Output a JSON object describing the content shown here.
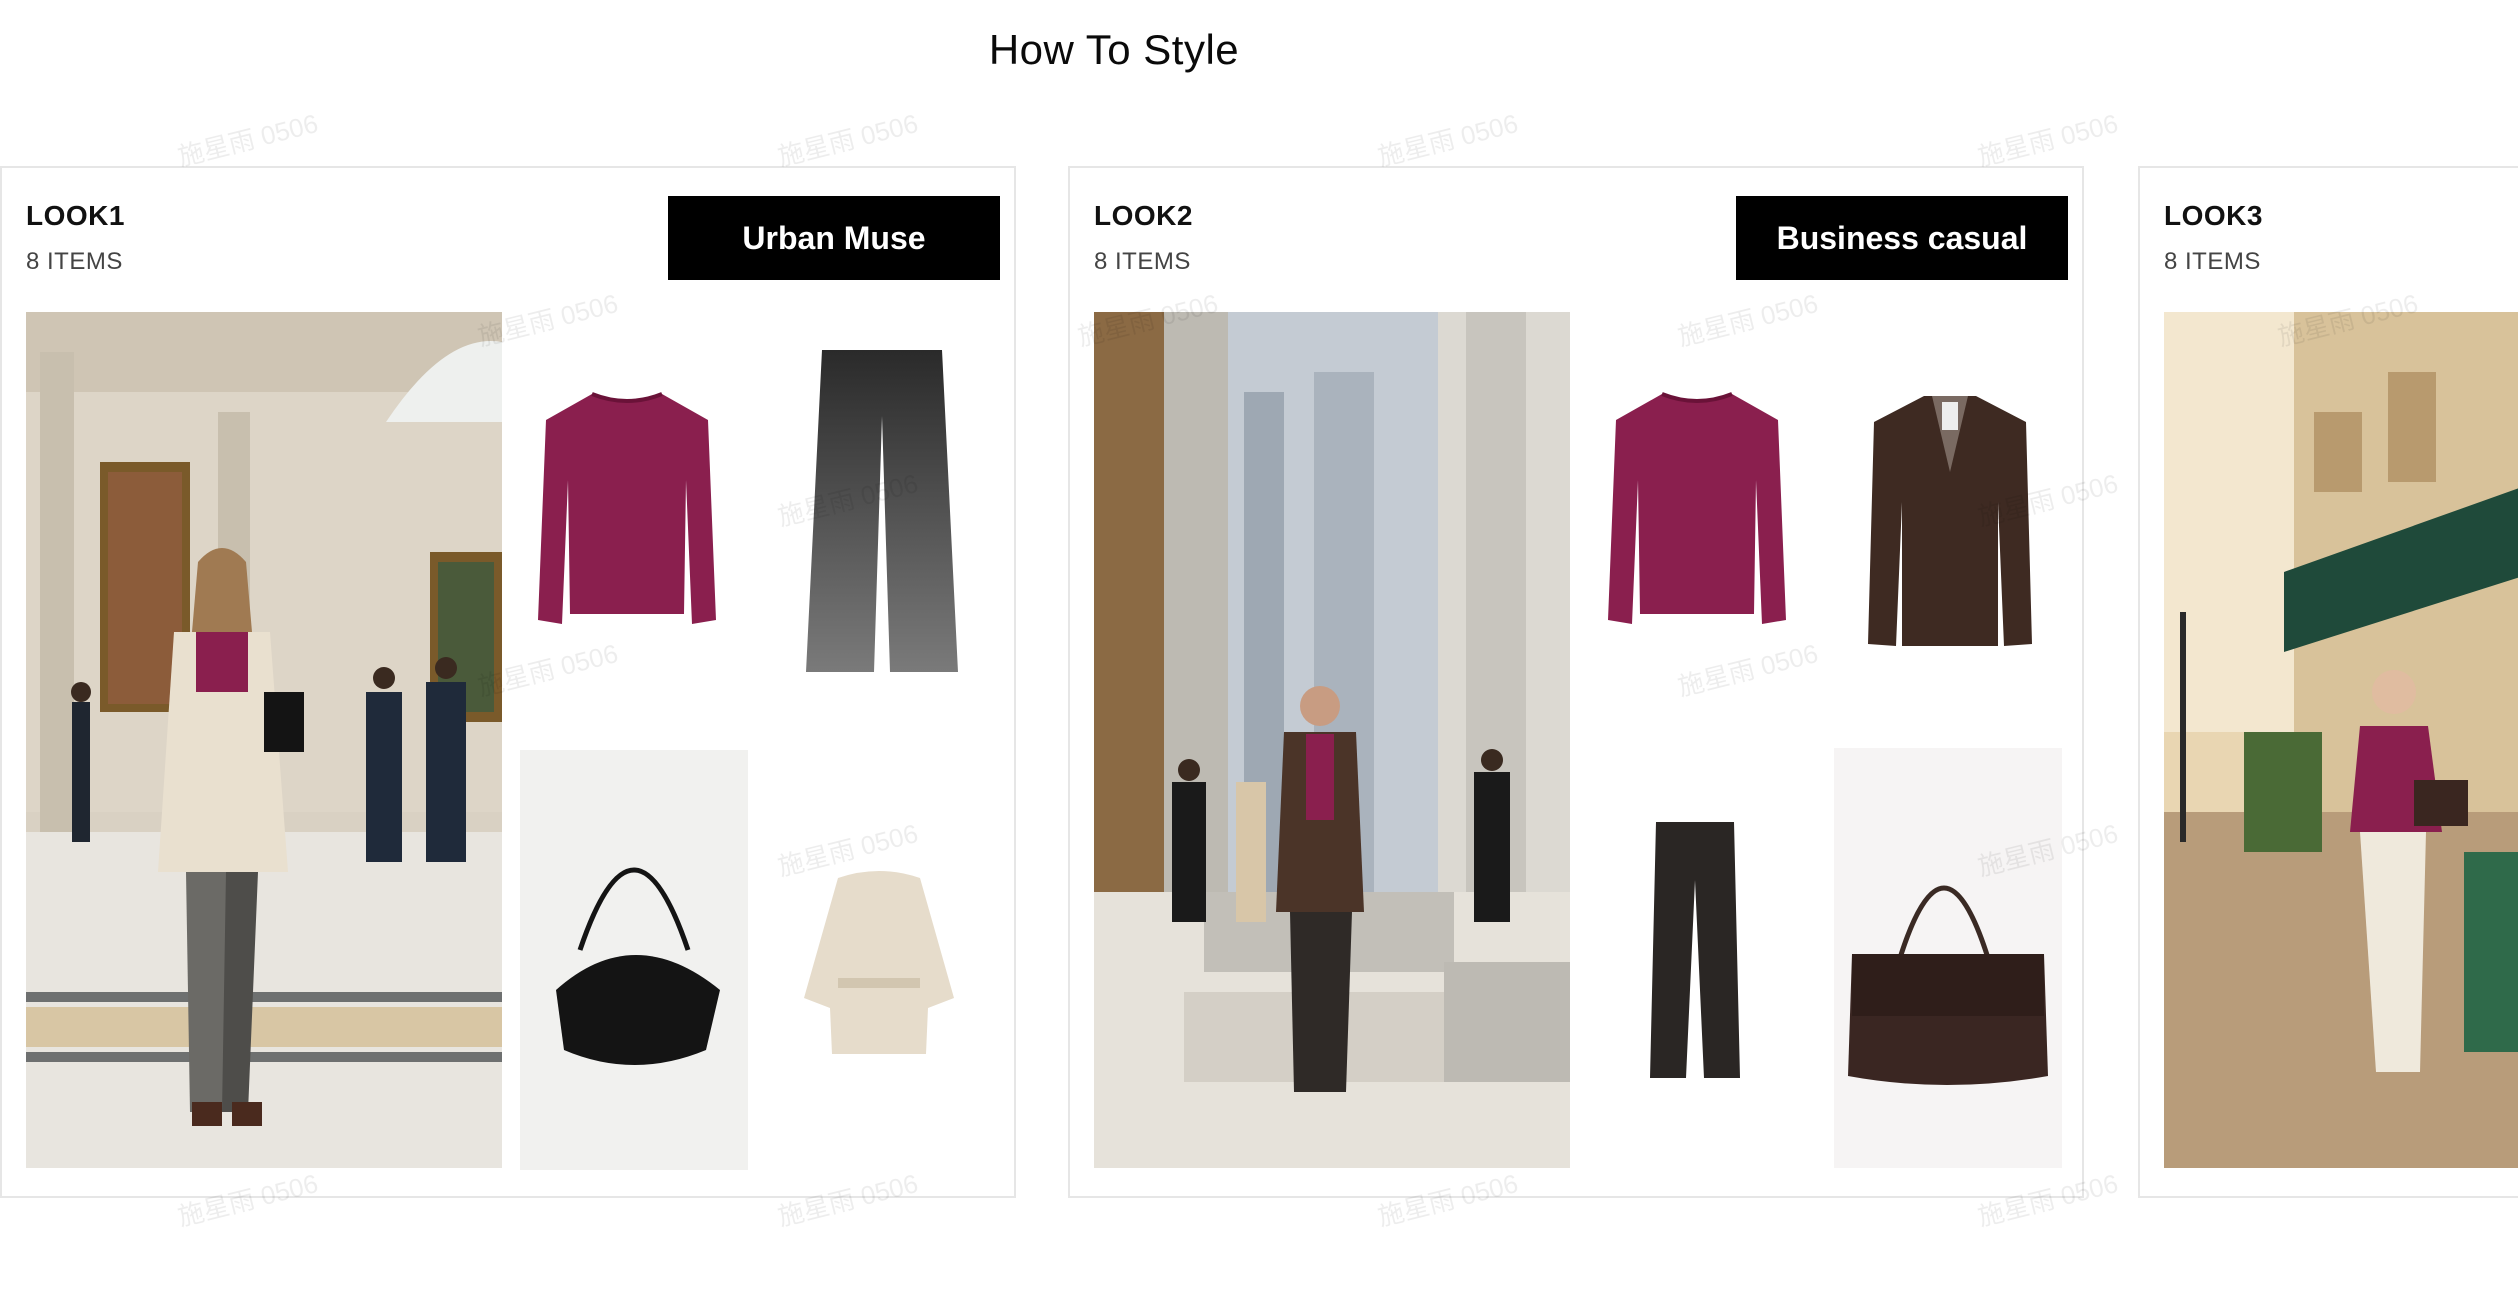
{
  "page": {
    "title": "How To Style"
  },
  "watermark": "施星雨 0506",
  "looks": [
    {
      "title": "LOOK1",
      "count": "8 ITEMS",
      "tag": "Urban Muse"
    },
    {
      "title": "LOOK2",
      "count": "8 ITEMS",
      "tag": "Business casual"
    },
    {
      "title": "LOOK3",
      "count": "8 ITEMS",
      "tag": ""
    }
  ],
  "colors": {
    "tag_bg": "#000000",
    "border": "#e6e6e6",
    "sweater": "#8a1f4e"
  }
}
